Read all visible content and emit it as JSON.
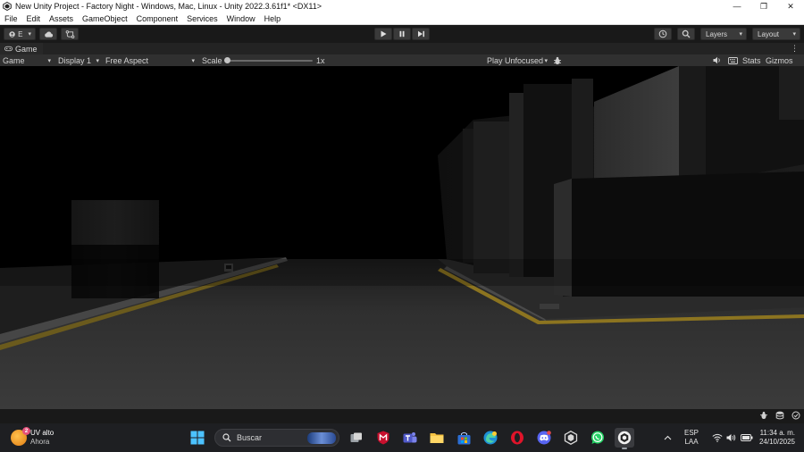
{
  "window": {
    "title": "New Unity Project - Factory Night - Windows, Mac, Linux - Unity 2022.3.61f1* <DX11>",
    "controls": {
      "minimize": "—",
      "maximize": "❐",
      "close": "✕"
    }
  },
  "menu": [
    "File",
    "Edit",
    "Assets",
    "GameObject",
    "Component",
    "Services",
    "Window",
    "Help"
  ],
  "toolbar": {
    "account_label": "E",
    "layers_label": "Layers",
    "layout_label": "Layout"
  },
  "panel": {
    "tab_label": "Game",
    "more": "⋮"
  },
  "gamebar": {
    "mode": "Game",
    "display": "Display 1",
    "aspect": "Free Aspect",
    "scale_label": "Scale",
    "scale_value": "1x",
    "scale_fraction": 0.0,
    "play_mode": "Play Unfocused",
    "stats": "Stats",
    "gizmos": "Gizmos"
  },
  "taskbar": {
    "weather": {
      "title": "UV alto",
      "subtitle": "Ahora",
      "badge": "2"
    },
    "search_label": "Buscar",
    "language": {
      "line1": "ESP",
      "line2": "LAA"
    },
    "clock": {
      "time": "11:34 a. m.",
      "date": "24/10/2025"
    }
  },
  "colors": {
    "unity_dark": "#191919",
    "panel": "#303030",
    "floor_line": "#8c7420",
    "taskbar": "#1e1f22"
  }
}
